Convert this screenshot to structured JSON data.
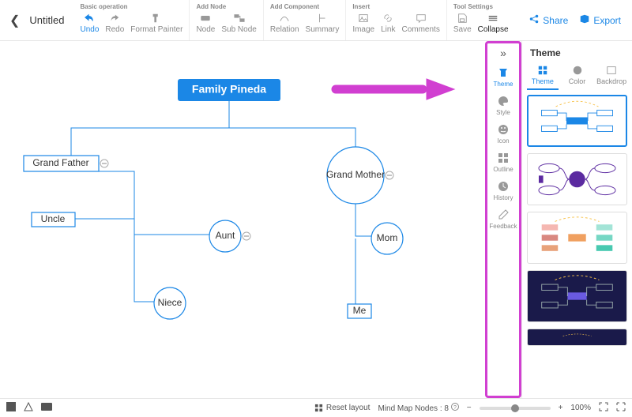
{
  "doc": {
    "title": "Untitled"
  },
  "toolbar": {
    "groups": {
      "basic": {
        "title": "Basic operation",
        "undo": "Undo",
        "redo": "Redo",
        "format_painter": "Format Painter"
      },
      "addnode": {
        "title": "Add Node",
        "node": "Node",
        "subnode": "Sub Node"
      },
      "addcomp": {
        "title": "Add Component",
        "relation": "Relation",
        "summary": "Summary"
      },
      "insert": {
        "title": "Insert",
        "image": "Image",
        "link": "Link",
        "comments": "Comments"
      },
      "tools": {
        "title": "Tool Settings",
        "save": "Save",
        "collapse": "Collapse"
      }
    },
    "share": "Share",
    "export": "Export"
  },
  "mindmap": {
    "root": "Family Pineda",
    "grandfather": "Grand Father",
    "grandmother": "Grand Mother",
    "uncle": "Uncle",
    "aunt": "Aunt",
    "niece": "Niece",
    "mom": "Mom",
    "me": "Me"
  },
  "side_rail": {
    "theme": "Theme",
    "style": "Style",
    "icon": "Icon",
    "outline": "Outline",
    "history": "History",
    "feedback": "Feedback"
  },
  "theme_panel": {
    "title": "Theme",
    "tabs": {
      "theme": "Theme",
      "color": "Color",
      "backdrop": "Backdrop"
    }
  },
  "statusbar": {
    "reset": "Reset layout",
    "nodes_label": "Mind Map Nodes :",
    "nodes_count": "8",
    "zoom": "100%"
  }
}
